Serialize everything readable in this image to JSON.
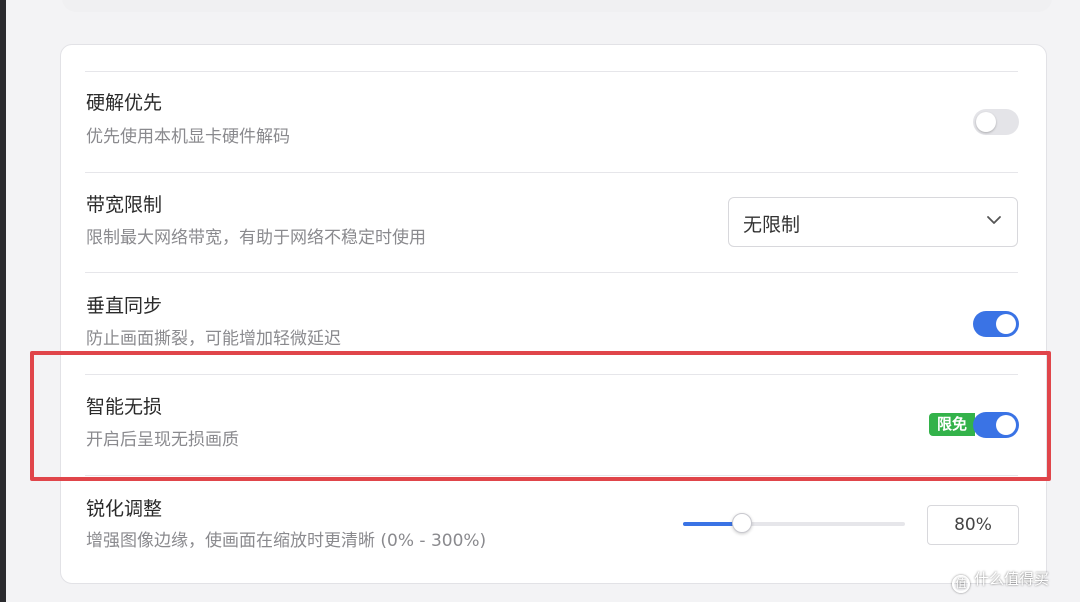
{
  "settings": {
    "hw_decode": {
      "title": "硬解优先",
      "desc": "优先使用本机显卡硬件解码",
      "enabled": false
    },
    "bandwidth": {
      "title": "带宽限制",
      "desc": "限制最大网络带宽，有助于网络不稳定时使用",
      "selected": "无限制"
    },
    "vsync": {
      "title": "垂直同步",
      "desc": "防止画面撕裂，可能增加轻微延迟",
      "enabled": true
    },
    "smart_lossless": {
      "title": "智能无损",
      "desc": "开启后呈现无损画质",
      "badge": "限免",
      "enabled": true
    },
    "sharpen": {
      "title": "锐化调整",
      "desc": "增强图像边缘，使画面在缩放时更清晰 (0% - 300%)",
      "value_label": "80%",
      "value": 80,
      "min": 0,
      "max": 300
    }
  },
  "watermark": {
    "text": "什么值得买",
    "icon": "值"
  },
  "colors": {
    "accent": "#3a73e5",
    "badge": "#33b24a",
    "highlight": "#e0454a"
  }
}
